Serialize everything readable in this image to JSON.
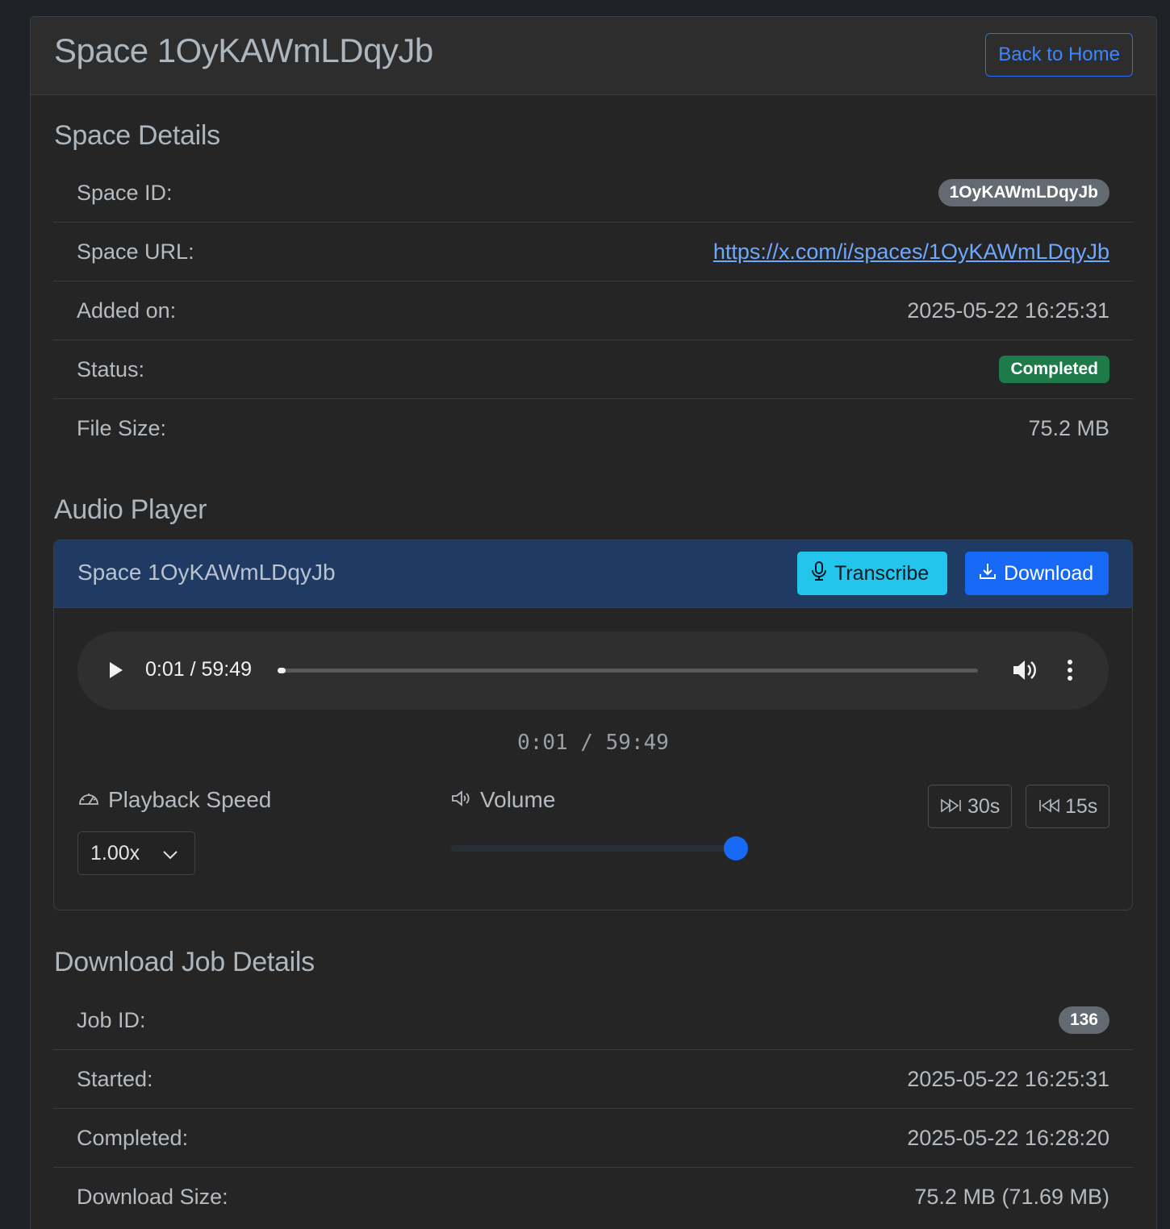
{
  "header": {
    "title": "Space 1OyKAWmLDqyJb",
    "back_label": "Back to Home"
  },
  "space_details": {
    "title": "Space Details",
    "rows": [
      {
        "label": "Space ID:",
        "value": "1OyKAWmLDqyJb"
      },
      {
        "label": "Space URL:",
        "value": "https://x.com/i/spaces/1OyKAWmLDqyJb"
      },
      {
        "label": "Added on:",
        "value": "2025-05-22 16:25:31"
      },
      {
        "label": "Status:",
        "value": "Completed"
      },
      {
        "label": "File Size:",
        "value": "75.2 MB"
      }
    ]
  },
  "audio_player": {
    "title": "Audio Player",
    "card_title": "Space 1OyKAWmLDqyJb",
    "transcribe_label": "Transcribe",
    "download_label": "Download",
    "native_time": "0:01 / 59:49",
    "progress": 0.005,
    "custom_time": "0:01 / 59:49",
    "speed_label": "Playback Speed",
    "speed_value": "1.00x",
    "volume_label": "Volume",
    "volume_level": 1.0,
    "forward_label": "30s",
    "back_label": "15s"
  },
  "job_details": {
    "title": "Download Job Details",
    "rows": [
      {
        "label": "Job ID:",
        "value": "136"
      },
      {
        "label": "Started:",
        "value": "2025-05-22 16:25:31"
      },
      {
        "label": "Completed:",
        "value": "2025-05-22 16:28:20"
      },
      {
        "label": "Download Size:",
        "value": "75.2 MB (71.69 MB)"
      }
    ]
  },
  "colors": {
    "accent": "#1668f5",
    "info": "#24c5ec",
    "success": "#1d7a49",
    "badge_gray": "#646a71"
  }
}
